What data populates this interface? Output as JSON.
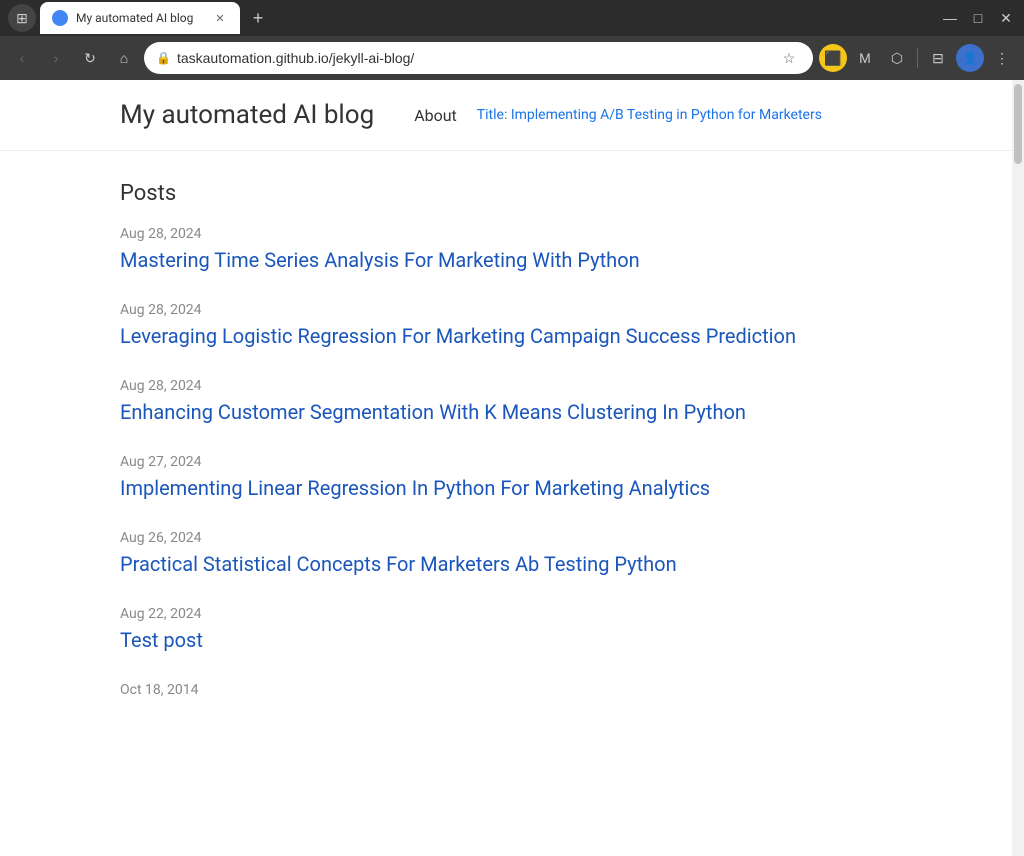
{
  "browser": {
    "tab_title": "My automated AI blog",
    "url": "taskautomation.github.io/jekyll-ai-blog/",
    "new_tab_label": "+"
  },
  "site": {
    "title": "My automated AI blog",
    "nav": {
      "about_label": "About",
      "highlight_label": "Title: Implementing A/B Testing in Python for Marketers"
    }
  },
  "posts_section": {
    "heading": "Posts",
    "posts": [
      {
        "date": "Aug 28, 2024",
        "title": "Mastering Time Series Analysis For Marketing With Python",
        "href": "#"
      },
      {
        "date": "Aug 28, 2024",
        "title": "Leveraging Logistic Regression For Marketing Campaign Success Prediction",
        "href": "#"
      },
      {
        "date": "Aug 28, 2024",
        "title": "Enhancing Customer Segmentation With K Means Clustering In Python",
        "href": "#"
      },
      {
        "date": "Aug 27, 2024",
        "title": "Implementing Linear Regression In Python For Marketing Analytics",
        "href": "#"
      },
      {
        "date": "Aug 26, 2024",
        "title": "Practical Statistical Concepts For Marketers Ab Testing Python",
        "href": "#"
      },
      {
        "date": "Aug 22, 2024",
        "title": "Test post",
        "href": "#"
      },
      {
        "date": "Oct 18, 2014",
        "title": "",
        "href": "#"
      }
    ]
  },
  "icons": {
    "back": "‹",
    "forward": "›",
    "reload": "↻",
    "home": "⌂",
    "star": "☆",
    "bookmark": "⊟",
    "menu": "⋮",
    "minimize": "—",
    "maximize": "□",
    "close": "✕",
    "lock": "🔒",
    "extensions": "⊞"
  },
  "colors": {
    "link": "#1a56bb",
    "date": "#888888",
    "nav_highlight": "#1a73e8"
  }
}
